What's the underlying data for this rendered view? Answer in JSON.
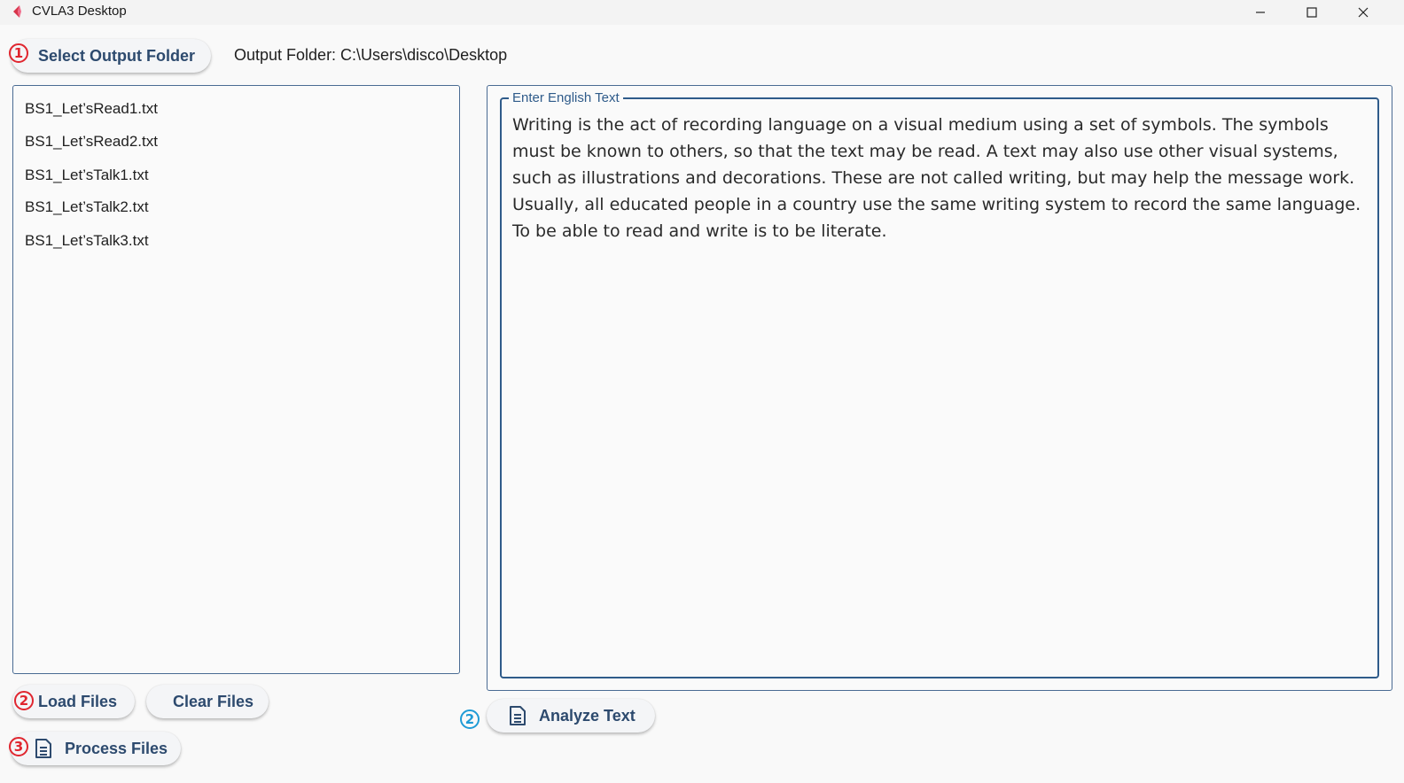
{
  "window": {
    "title": "CVLA3 Desktop"
  },
  "toolbar": {
    "step1_badge": "1",
    "select_folder_label": "Select Output Folder",
    "output_folder_text": "Output Folder: C:\\Users\\disco\\Desktop"
  },
  "file_list": {
    "items": [
      "BS1_Let’sRead1.txt",
      "BS1_Let’sRead2.txt",
      "BS1_Let’sTalk1.txt",
      "BS1_Let’sTalk2.txt",
      "BS1_Let’sTalk3.txt"
    ]
  },
  "text_panel": {
    "legend": "Enter English Text",
    "content": "Writing is the act of recording language on a visual medium using a set of symbols. The symbols must be known to others, so that the text may be read. A text may also use other visual systems, such as illustrations and decorations. These are not called writing, but may help the message work. Usually, all educated people in a country use the same writing system to record the same language. To be able to read and write is to be literate."
  },
  "actions": {
    "step2_badge": "2",
    "load_files_label": "Load Files",
    "clear_files_label": "Clear Files",
    "step3_badge": "3",
    "process_files_label": "Process Files",
    "analyze_badge": "2",
    "analyze_text_label": "Analyze Text"
  },
  "icons": {
    "app": "app-logo-icon",
    "minimize": "minimize-icon",
    "maximize": "maximize-icon",
    "close": "close-icon",
    "document": "document-icon"
  },
  "colors": {
    "badge_red": "#e0262f",
    "badge_blue": "#1f9bd6",
    "button_text": "#2d4a6e",
    "border": "#2f5b8a"
  }
}
